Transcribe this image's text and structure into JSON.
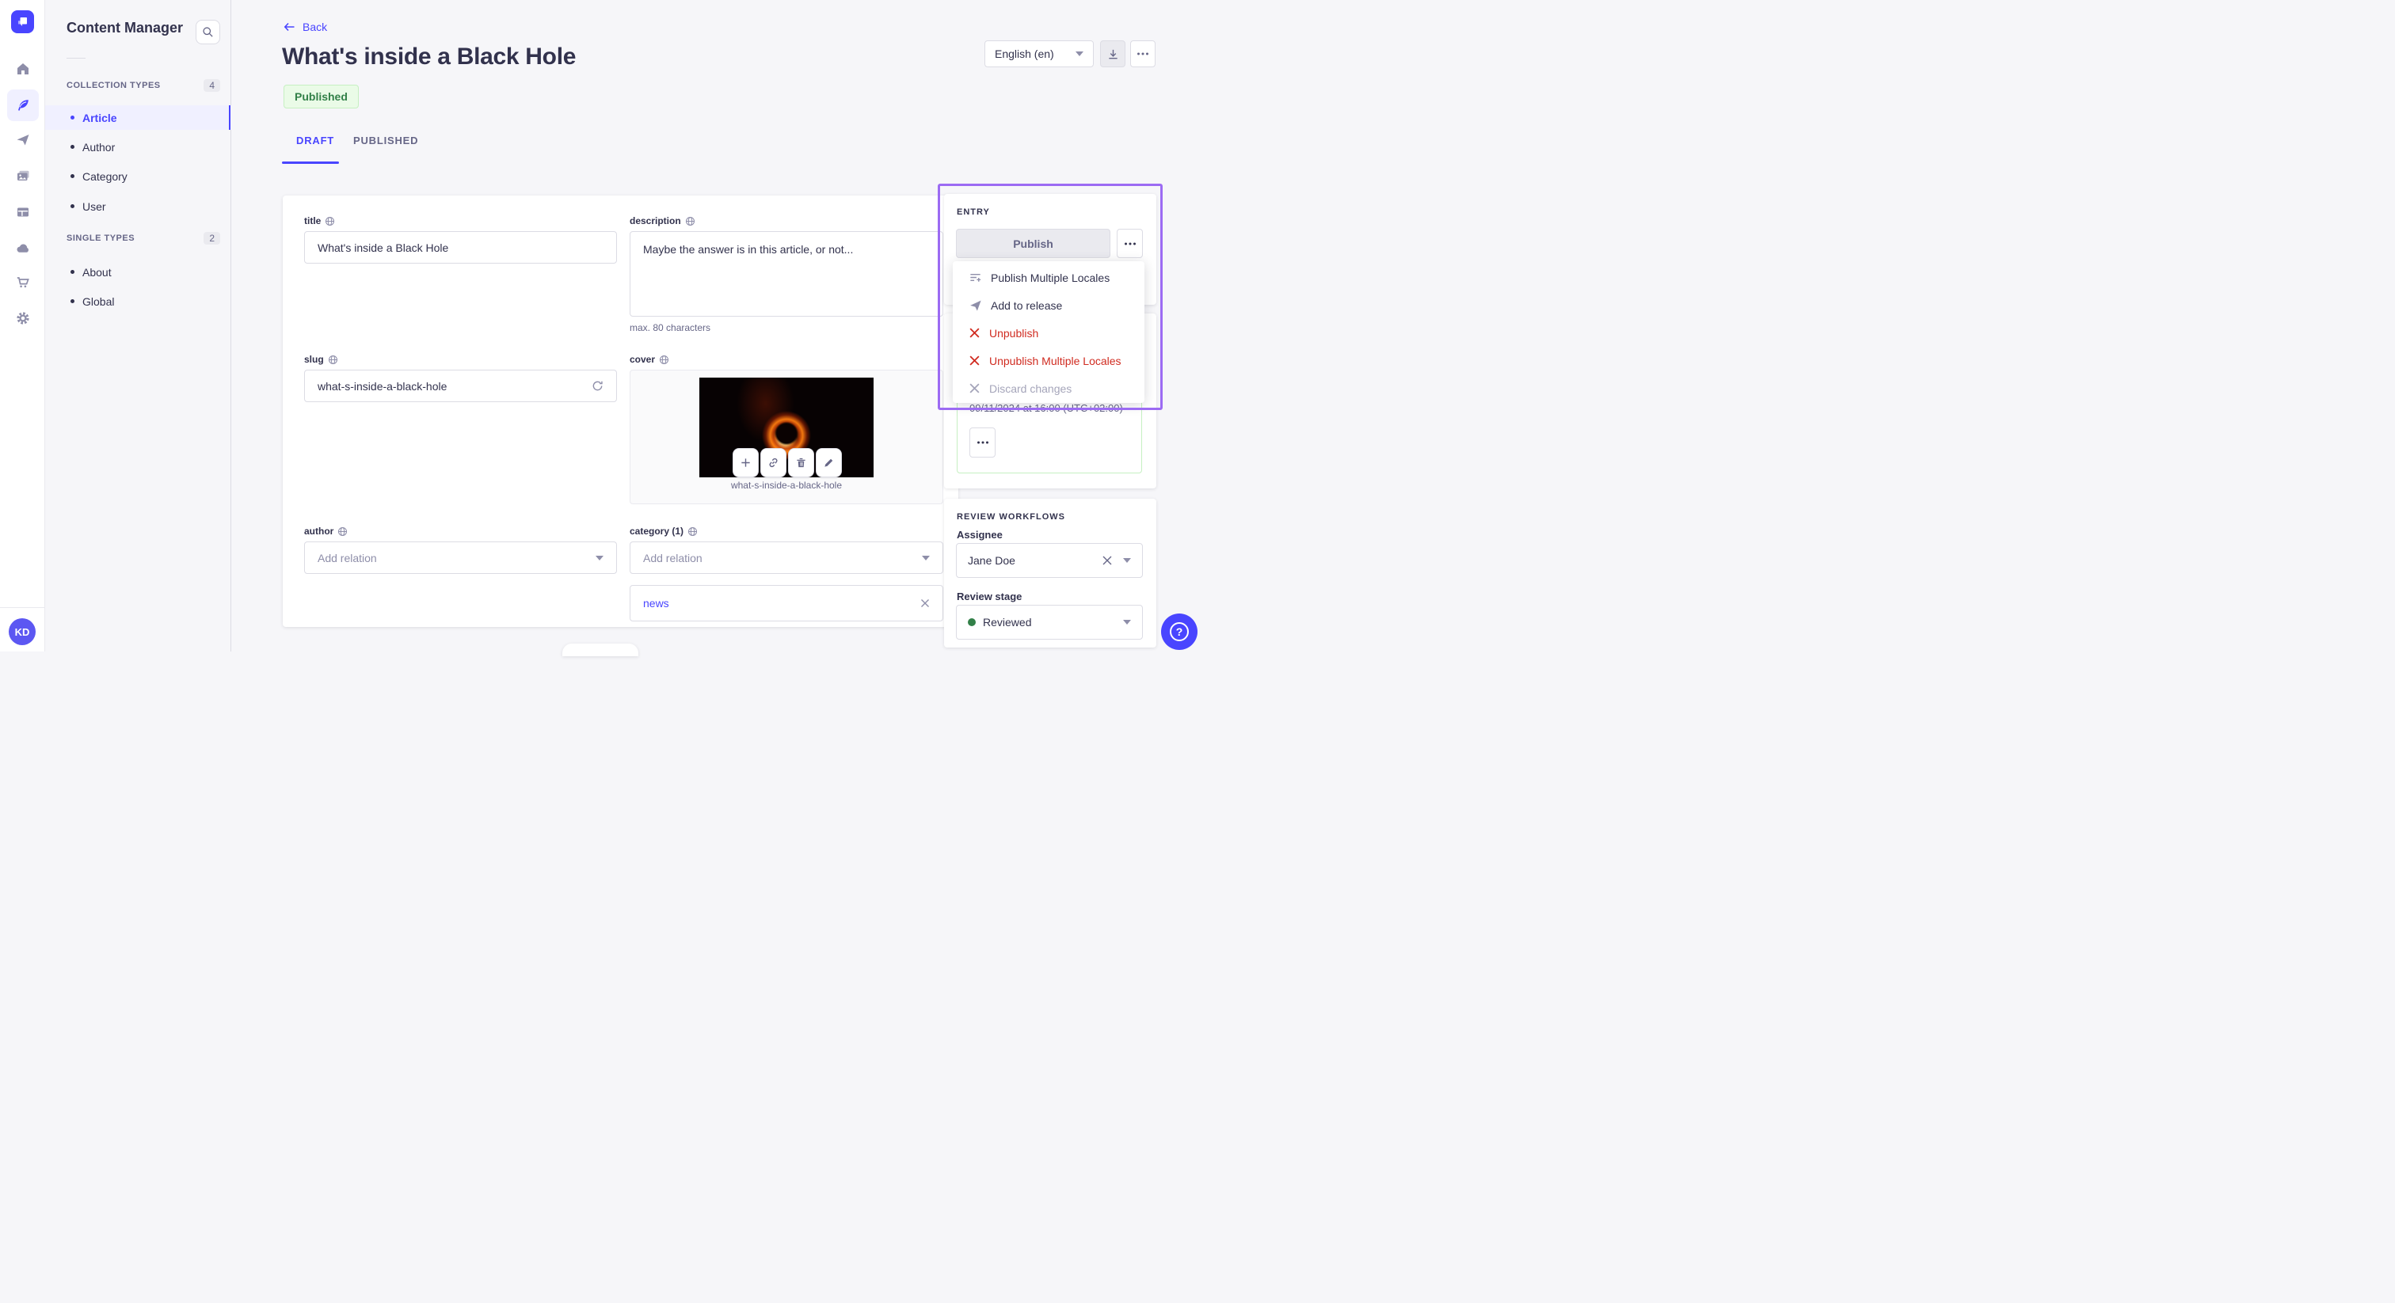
{
  "user": {
    "initials": "KD"
  },
  "subnav": {
    "title": "Content Manager",
    "collection_types": {
      "header": "COLLECTION TYPES",
      "count": "4",
      "items": [
        "Article",
        "Author",
        "Category",
        "User"
      ]
    },
    "single_types": {
      "header": "SINGLE TYPES",
      "count": "2",
      "items": [
        "About",
        "Global"
      ]
    }
  },
  "header": {
    "back_label": "Back",
    "title": "What's inside a Black Hole",
    "status_badge": "Published",
    "locale_value": "English (en)"
  },
  "tabs": {
    "draft": "DRAFT",
    "published": "PUBLISHED"
  },
  "form": {
    "title": {
      "label": "title",
      "value": "What's inside a Black Hole"
    },
    "description": {
      "label": "description",
      "value": "Maybe the answer is in this article, or not...",
      "hint": "max. 80 characters"
    },
    "slug": {
      "label": "slug",
      "value": "what-s-inside-a-black-hole"
    },
    "cover": {
      "label": "cover",
      "caption": "what-s-inside-a-black-hole"
    },
    "author": {
      "label": "author",
      "placeholder": "Add relation"
    },
    "category": {
      "label": "category (1)",
      "placeholder": "Add relation",
      "relations": [
        "news"
      ]
    }
  },
  "entry_panel": {
    "header": "ENTRY",
    "publish_label": "Publish",
    "menu": {
      "items": [
        {
          "label": "Publish Multiple Locales",
          "kind": "default"
        },
        {
          "label": "Add to release",
          "kind": "default"
        },
        {
          "label": "Unpublish",
          "kind": "danger"
        },
        {
          "label": "Unpublish Multiple Locales",
          "kind": "danger"
        },
        {
          "label": "Discard changes",
          "kind": "disabled"
        }
      ]
    },
    "scheduled_date": "09/11/2024 at 16:00 (UTC+02:00)"
  },
  "review_workflows": {
    "header": "REVIEW WORKFLOWS",
    "assignee_label": "Assignee",
    "assignee_value": "Jane Doe",
    "stage_label": "Review stage",
    "stage_value": "Reviewed"
  },
  "help_glyph": "?",
  "colors": {
    "primary": "#4945ff",
    "danger": "#d02b20",
    "success_text": "#328048",
    "success_bg": "#eafbe7",
    "success_border": "#c6f0c2",
    "annotation": "#9c6bf3"
  }
}
